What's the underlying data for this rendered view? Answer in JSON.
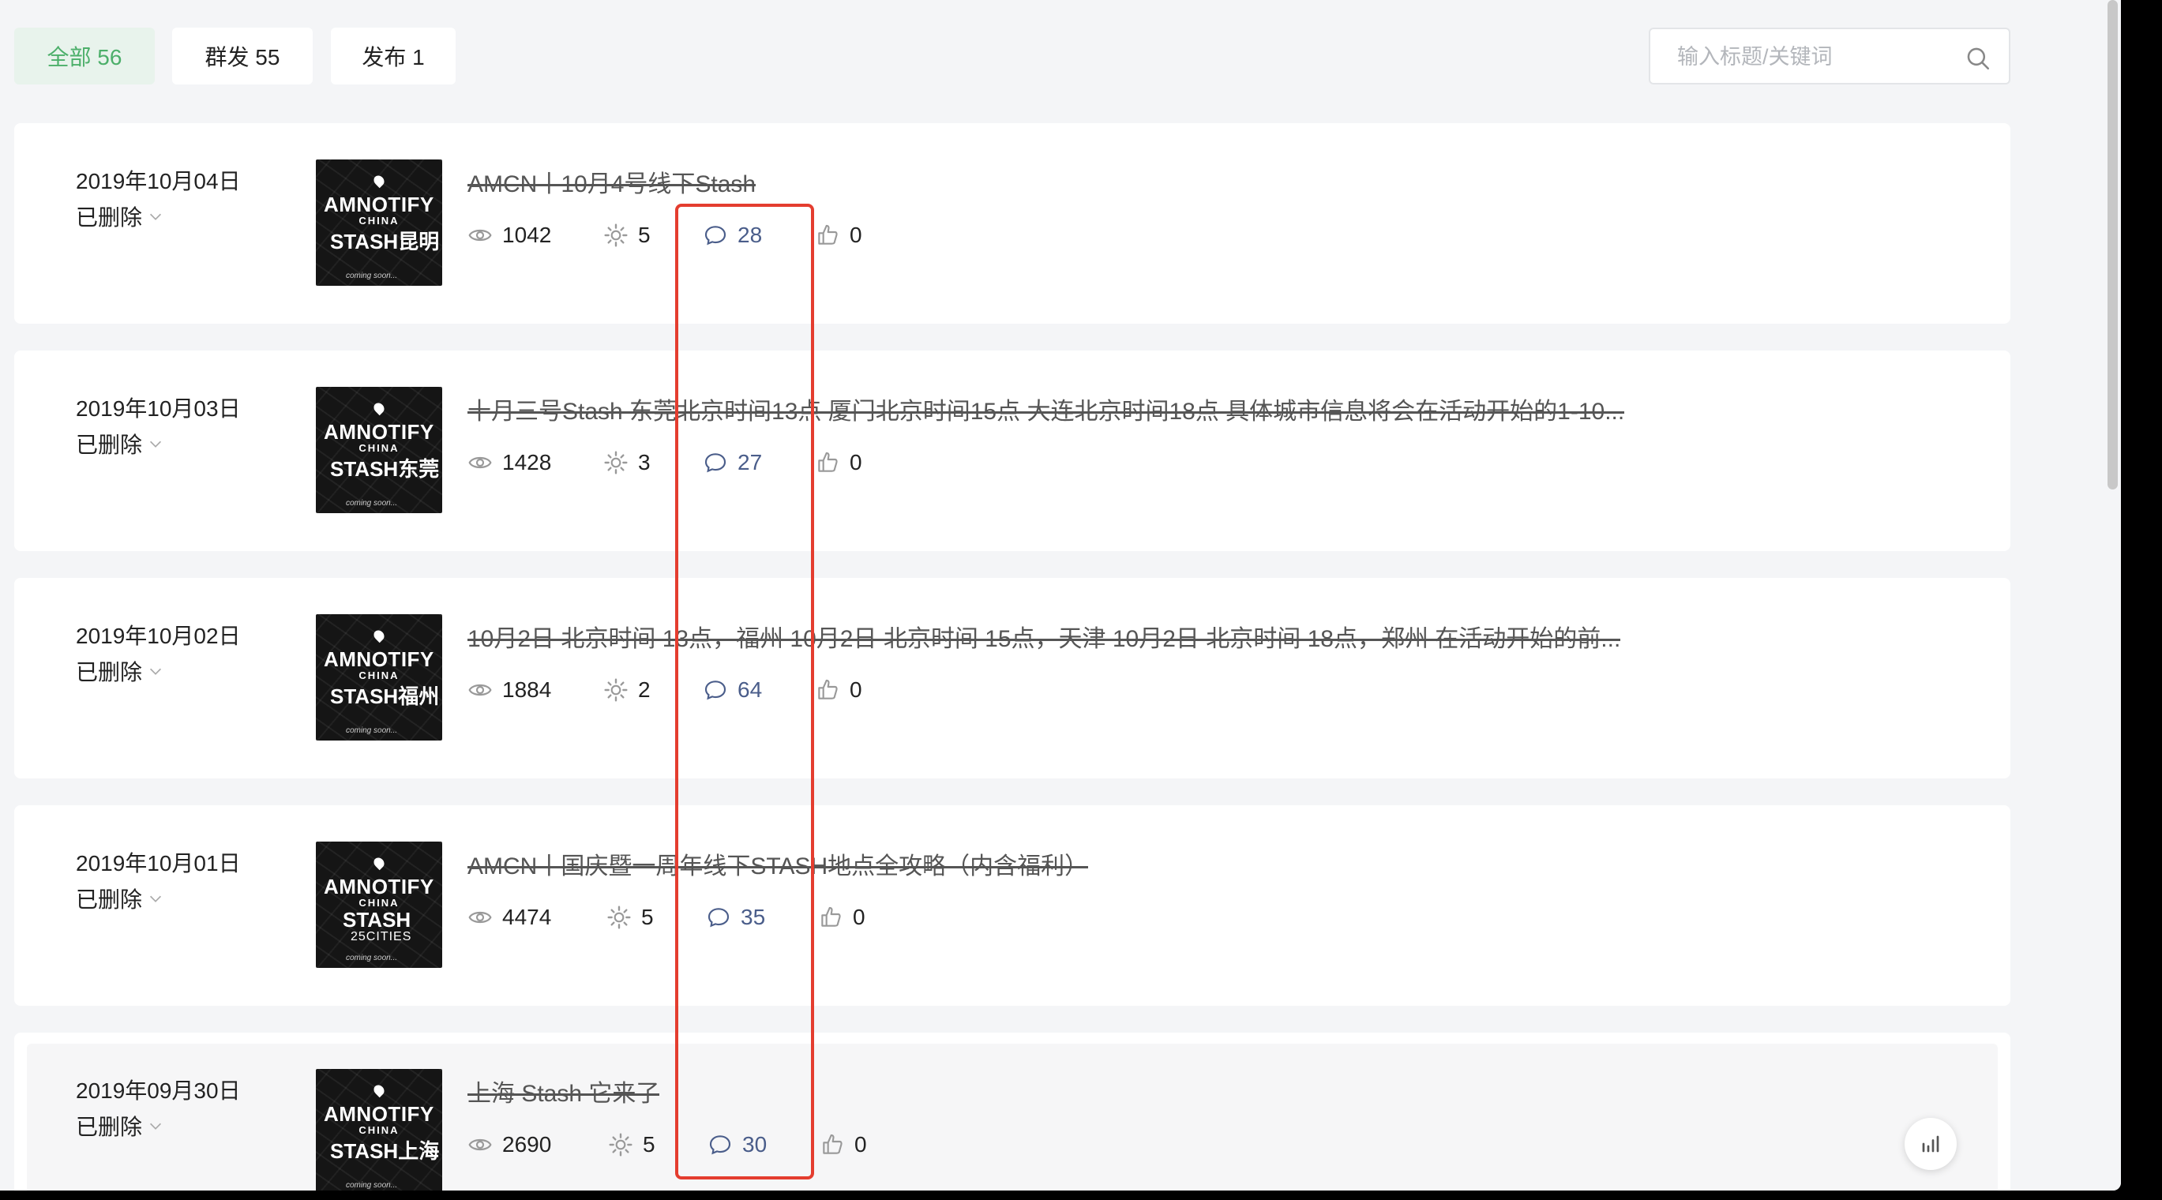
{
  "tabs": [
    {
      "label": "全部 56",
      "active": true
    },
    {
      "label": "群发 55",
      "active": false
    },
    {
      "label": "发布 1",
      "active": false
    }
  ],
  "search": {
    "placeholder": "输入标题/关键词"
  },
  "articles": [
    {
      "date": "2019年10月04日",
      "status": "已删除",
      "title": "AMCN丨10月4号线下Stash",
      "views": "1042",
      "shares": "5",
      "comments": "28",
      "likes": "0",
      "thumb": {
        "line1": "AMNOTIFY",
        "line2": "CHINA",
        "line3": "STASH昆明",
        "line4": "",
        "footer": "coming soon..."
      }
    },
    {
      "date": "2019年10月03日",
      "status": "已删除",
      "title": "十月三号Stash 东莞北京时间13点 厦门北京时间15点 大连北京时间18点 具体城市信息将会在活动开始的1-10...",
      "views": "1428",
      "shares": "3",
      "comments": "27",
      "likes": "0",
      "thumb": {
        "line1": "AMNOTIFY",
        "line2": "CHINA",
        "line3": "STASH东莞",
        "line4": "",
        "footer": "coming soon..."
      }
    },
    {
      "date": "2019年10月02日",
      "status": "已删除",
      "title": "10月2日 北京时间 13点，福州 10月2日 北京时间 15点，天津 10月2日 北京时间 18点，郑州 在活动开始的前...",
      "views": "1884",
      "shares": "2",
      "comments": "64",
      "likes": "0",
      "thumb": {
        "line1": "AMNOTIFY",
        "line2": "CHINA",
        "line3": "STASH福州",
        "line4": "",
        "footer": "coming soon..."
      }
    },
    {
      "date": "2019年10月01日",
      "status": "已删除",
      "title": "AMCN丨国庆暨一周年线下STASH地点全攻略（内含福利）",
      "views": "4474",
      "shares": "5",
      "comments": "35",
      "likes": "0",
      "thumb": {
        "line1": "AMNOTIFY",
        "line2": "CHINA",
        "line3": "STASH",
        "line4": "25CITIES",
        "footer": "coming soon..."
      }
    },
    {
      "date": "2019年09月30日",
      "status": "已删除",
      "title": "上海 Stash 它来了",
      "views": "2690",
      "shares": "5",
      "comments": "30",
      "likes": "0",
      "thumb": {
        "line1": "AMNOTIFY",
        "line2": "CHINA",
        "line3": "STASH上海",
        "line4": "",
        "footer": "coming soon..."
      }
    }
  ],
  "colors": {
    "accent": "#4caf6a",
    "highlight": "#e43d2f",
    "comment": "#4a5d8a"
  }
}
